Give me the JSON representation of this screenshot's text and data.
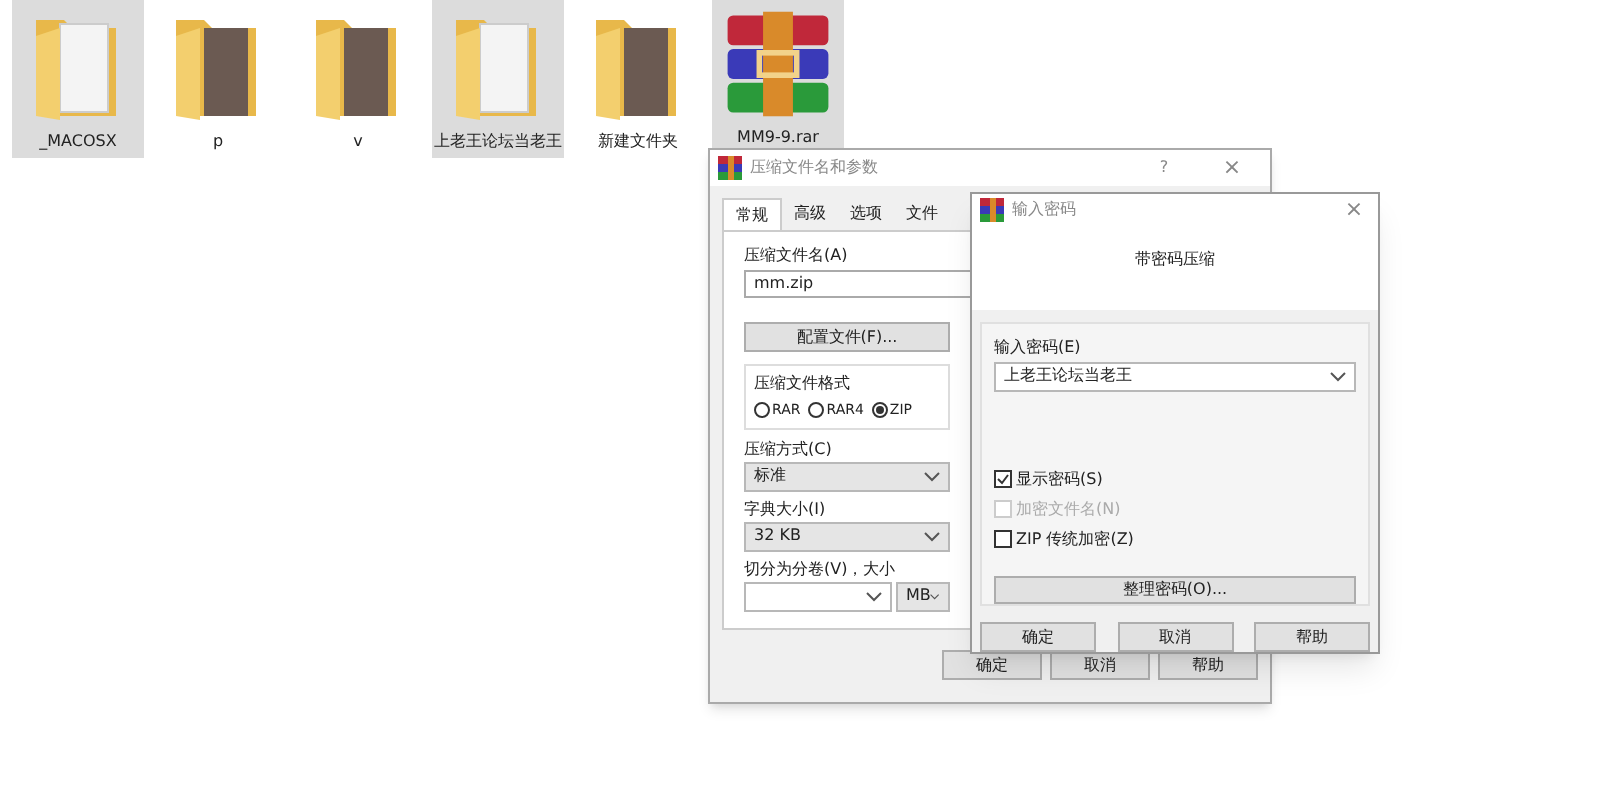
{
  "desktop": {
    "items": [
      {
        "label": "_MACOSX",
        "kind": "folder-doc",
        "selected": true
      },
      {
        "label": "p",
        "kind": "folder-photo",
        "selected": false
      },
      {
        "label": "v",
        "kind": "folder-photo",
        "selected": false
      },
      {
        "label": "上老王论坛当老王",
        "kind": "folder-doc",
        "selected": true
      },
      {
        "label": "新建文件夹",
        "kind": "folder-photo",
        "selected": false
      },
      {
        "label": "MM9-9.rar",
        "kind": "archive",
        "selected": true
      }
    ]
  },
  "archive_dialog": {
    "title": "压缩文件名和参数",
    "help": "?",
    "close": "×",
    "tabs": [
      {
        "label": "常规",
        "selected": true
      },
      {
        "label": "高级",
        "selected": false
      },
      {
        "label": "选项",
        "selected": false
      },
      {
        "label": "文件",
        "selected": false
      }
    ],
    "filename_label": "压缩文件名(A)",
    "filename": "mm.zip",
    "profiles_button": "配置文件(F)...",
    "format_group": "压缩文件格式",
    "formats": [
      {
        "label": "RAR",
        "selected": false
      },
      {
        "label": "RAR4",
        "selected": false
      },
      {
        "label": "ZIP",
        "selected": true
      }
    ],
    "method_label": "压缩方式(C)",
    "method": "标准",
    "dict_label": "字典大小(I)",
    "dict": "32 KB",
    "split_label": "切分为分卷(V)，大小",
    "split_unit": "MB",
    "buttons": [
      "确定",
      "取消",
      "帮助"
    ]
  },
  "password_dialog": {
    "title": "输入密码",
    "close": "×",
    "heading": "带密码压缩",
    "password_label": "输入密码(E)",
    "password": "上老王论坛当老王",
    "options": [
      {
        "label": "显示密码(S)",
        "checked": true,
        "disabled": false
      },
      {
        "label": "加密文件名(N)",
        "checked": false,
        "disabled": true
      },
      {
        "label": "ZIP 传统加密(Z)",
        "checked": false,
        "disabled": false
      }
    ],
    "organize_button": "整理密码(O)...",
    "buttons": [
      "确定",
      "取消",
      "帮助"
    ]
  }
}
